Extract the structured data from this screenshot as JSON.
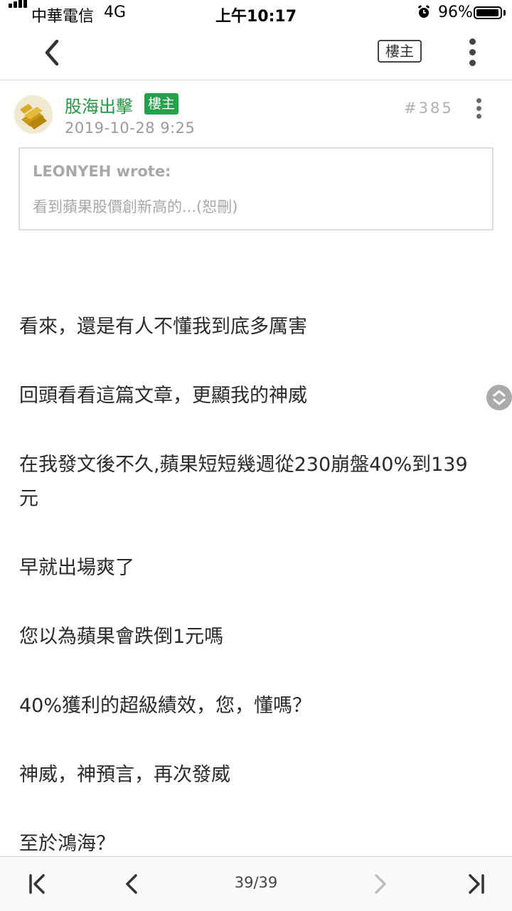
{
  "status_bar": {
    "carrier": "中華電信",
    "network": "4G",
    "time": "上午10:17",
    "battery": "96%",
    "battery_level": 0.96
  },
  "nav": {
    "back_icon": "chevron-left-icon",
    "op_filter_label": "樓主",
    "more_icon": "vertical-dots-icon"
  },
  "post": {
    "author": "股海出擊",
    "op_badge": "樓主",
    "date": "2019-10-28 9:25",
    "floor": "#385",
    "quote": {
      "author": "LEONYEH wrote:",
      "text": "看到蘋果股價創新高的...(恕刪)"
    },
    "paragraphs": [
      "看來，還是有人不懂我到底多厲害",
      "回頭看看這篇文章，更顯我的神威",
      "在我發文後不久,蘋果短短幾週從230崩盤40%到139元",
      "早就出場爽了",
      "您以為蘋果會跌倒1元嗎",
      "40%獲利的超級績效，您，懂嗎？",
      "神威，神預言，再次發威",
      "至於鴻海？"
    ]
  },
  "pagination": {
    "label": "39/39"
  },
  "colors": {
    "accent_green": "#24a14b",
    "author_green": "#1e9a3c"
  }
}
